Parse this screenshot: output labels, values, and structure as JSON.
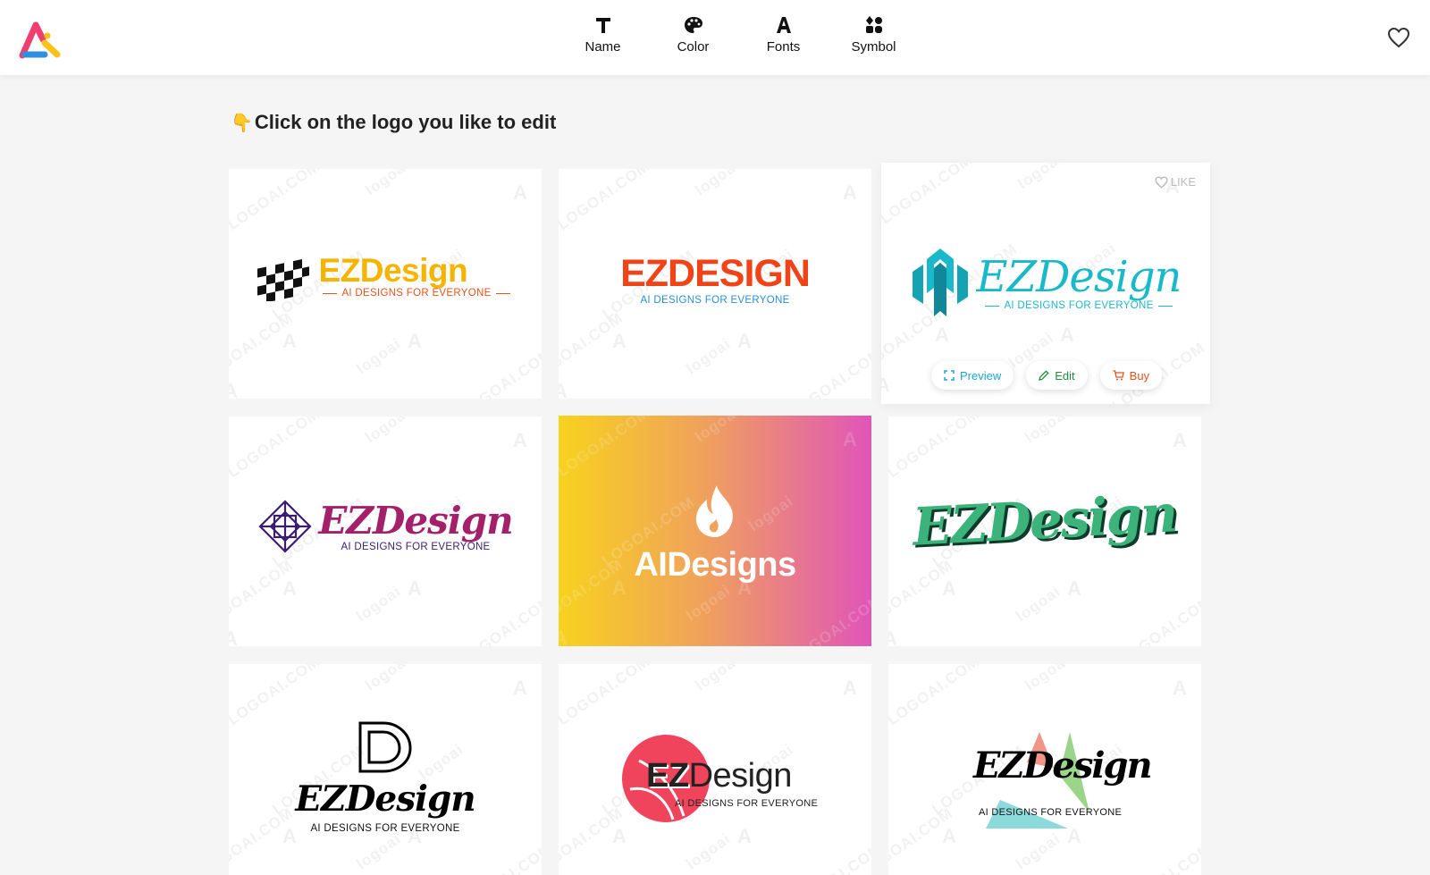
{
  "nav": [
    {
      "label": "Name",
      "icon": "text-t-icon"
    },
    {
      "label": "Color",
      "icon": "palette-icon"
    },
    {
      "label": "Fonts",
      "icon": "font-a-icon"
    },
    {
      "label": "Symbol",
      "icon": "symbol-grid-icon"
    }
  ],
  "instruction": {
    "emoji": "👇",
    "text": "Click on the logo you like to edit"
  },
  "watermark": {
    "text": "LOGOAI.COM",
    "script": "logoai"
  },
  "logos": [
    {
      "name": "EZDesign",
      "tagline": "AI DESIGNS FOR EVERYONE",
      "colors": {
        "primary": "#f4b400",
        "tagline": "#e8521a",
        "icon": "#111111"
      }
    },
    {
      "name": "EZDESIGN",
      "tagline": "AI DESIGNS FOR EVERYONE",
      "colors": {
        "primary": "#f04418",
        "tagline": "#2a8fd8"
      }
    },
    {
      "name": "EZDesign",
      "tagline": "AI DESIGNS FOR EVERYONE",
      "colors": {
        "primary": "#1ab9c9",
        "tagline": "#1ab9c9"
      },
      "like_label": "LIKE",
      "actions": [
        {
          "label": "Preview",
          "color": "#1aa5d9",
          "icon": "expand-icon"
        },
        {
          "label": "Edit",
          "color": "#1e8f3c",
          "icon": "pencil-icon"
        },
        {
          "label": "Buy",
          "color": "#e8521a",
          "icon": "cart-icon"
        }
      ]
    },
    {
      "name": "EZDesign",
      "tagline": "AI DESIGNS FOR EVERYONE",
      "colors": {
        "primary": "#a5206b",
        "tagline": "#3a1d6e",
        "icon": "#3a1d6e"
      }
    },
    {
      "name": "AIDesigns",
      "colors": {
        "text": "#ffffff",
        "gradient_start": "#f7d21e",
        "gradient_mid": "#f0a35a",
        "gradient_end": "#e055b8"
      }
    },
    {
      "name": "EZDesign",
      "colors": {
        "primary": "#3cb37a",
        "shadow": "#0f3b2a"
      }
    },
    {
      "name": "EZDesign",
      "tagline": "AI DESIGNS FOR EVERYONE",
      "colors": {
        "primary": "#000000"
      }
    },
    {
      "name": "EZDesign",
      "name_parts": [
        "EZ",
        "Design"
      ],
      "tagline": "AI DESIGNS FOR EVERYONE",
      "colors": {
        "primary": "#222222",
        "circle": "#f0445c"
      }
    },
    {
      "name": "EZDesign",
      "tagline": "AI DESIGNS FOR EVERYONE",
      "colors": {
        "primary": "#000000",
        "shape_green": "#8fd07c",
        "shape_red": "#f08a7a",
        "shape_teal": "#7fd6d8"
      }
    }
  ]
}
